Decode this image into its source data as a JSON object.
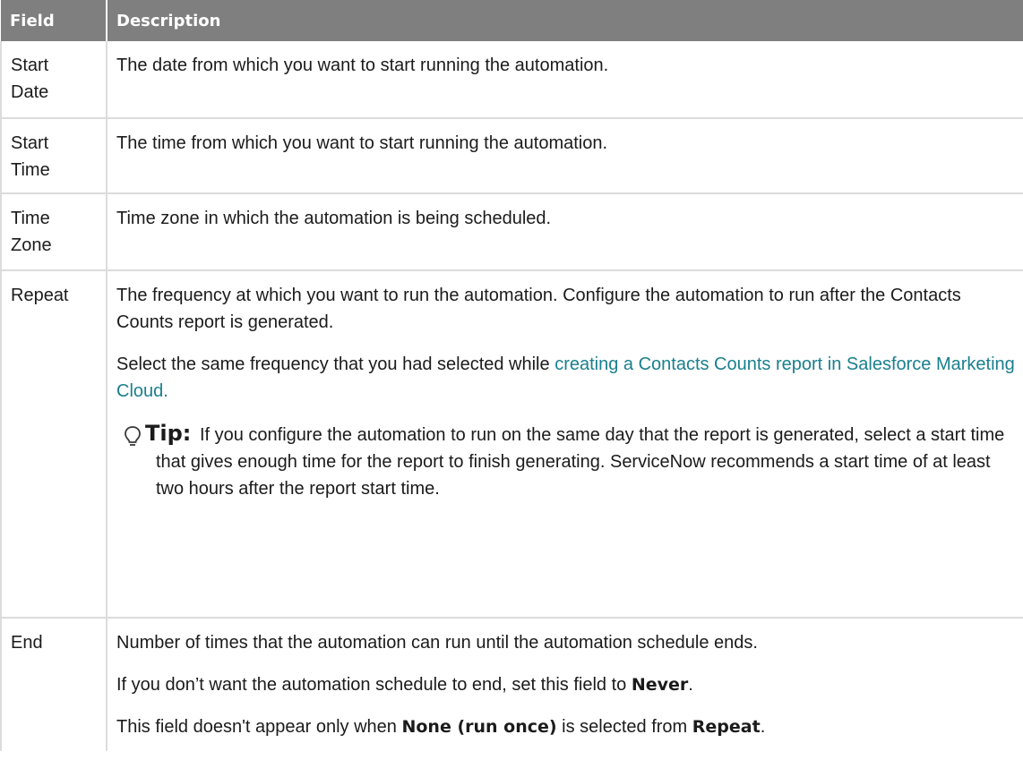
{
  "table": {
    "headers": [
      "Field",
      "Description"
    ],
    "rows": [
      {
        "field_line1": "Start",
        "field_line2": "Date",
        "desc": "The date from which you want to start running the automation."
      },
      {
        "field_line1": "Start",
        "field_line2": "Time",
        "desc": "The time from which you want to start running the automation."
      },
      {
        "field_line1": "Time",
        "field_line2": "Zone",
        "desc": "Time zone in which the automation is being scheduled."
      },
      {
        "field": "Repeat",
        "desc_p1": "The frequency at which you want to run the automation. Configure the automation to run after the Contacts Counts report is generated.",
        "desc_p2_before": "Select the same frequency that you had selected while ",
        "desc_p2_link": "creating a Contacts Counts report in Salesforce Marketing Cloud.",
        "tip_icon": "lightbulb-icon",
        "tip_label": "Tip:",
        "tip_text": "If you configure the automation to run on the same day that the report is generated, select a start time that gives enough time for the report to finish generating. ServiceNow recommends a start time of at least two hours after the report start time."
      },
      {
        "field": "End",
        "desc_p1": "Number of times that the automation can run until the automation schedule ends.",
        "desc_p2_before": "If you don’t want the automation schedule to end, set this field to ",
        "desc_p2_bold": "Never",
        "desc_p2_after": ".",
        "desc_p3_before": "This field doesn't appear only when ",
        "desc_p3_bold1": "None (run once)",
        "desc_p3_mid": " is selected from ",
        "desc_p3_bold2": "Repeat",
        "desc_p3_after": "."
      }
    ]
  },
  "colors": {
    "header_bg": "#7f7f7f",
    "link": "#1a7f8e",
    "grid": "#dcdcdc"
  }
}
